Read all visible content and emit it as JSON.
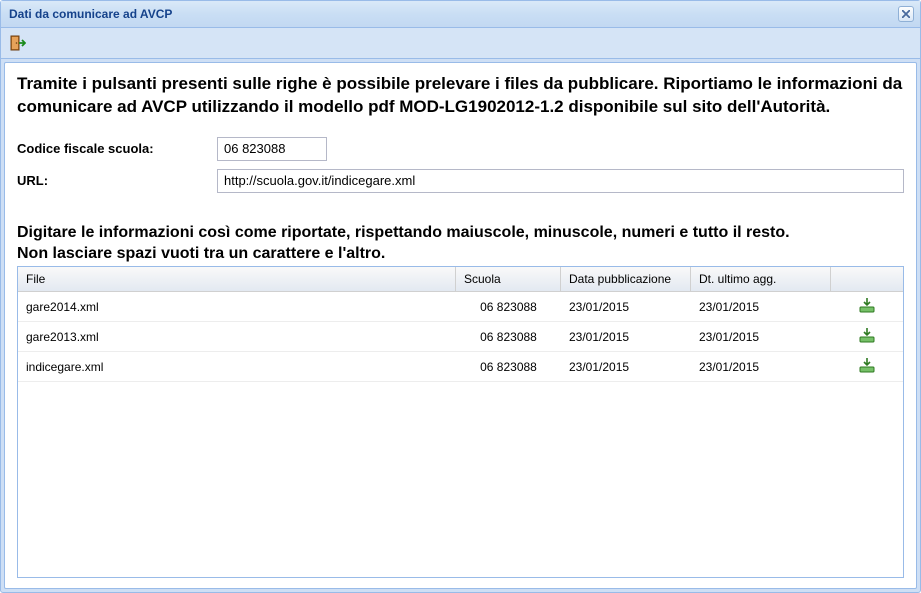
{
  "window": {
    "title": "Dati da comunicare ad AVCP"
  },
  "intro_text": "Tramite i pulsanti presenti sulle righe è possibile prelevare i files da pubblicare. Riportiamo le informazioni da comunicare ad AVCP utilizzando il modello pdf MOD-LG1902012-1.2 disponibile sul sito dell'Autorità.",
  "form": {
    "cf_label": "Codice fiscale scuola:",
    "cf_value": "06 823088",
    "url_label": "URL:",
    "url_value": "http://scuola.gov.it/indicegare.xml"
  },
  "sub_line1": "Digitare le informazioni così come riportate, rispettando maiuscole, minuscole, numeri e tutto il resto.",
  "sub_line2": "Non lasciare spazi vuoti tra un carattere e l'altro.",
  "grid": {
    "headers": {
      "file": "File",
      "scuola": "Scuola",
      "data": "Data pubblicazione",
      "agg": "Dt. ultimo agg."
    },
    "rows": [
      {
        "file": "gare2014.xml",
        "scuola": "06 823088",
        "data": "23/01/2015",
        "agg": "23/01/2015"
      },
      {
        "file": "gare2013.xml",
        "scuola": "06 823088",
        "data": "23/01/2015",
        "agg": "23/01/2015"
      },
      {
        "file": "indicegare.xml",
        "scuola": "06 823088",
        "data": "23/01/2015",
        "agg": "23/01/2015"
      }
    ]
  }
}
